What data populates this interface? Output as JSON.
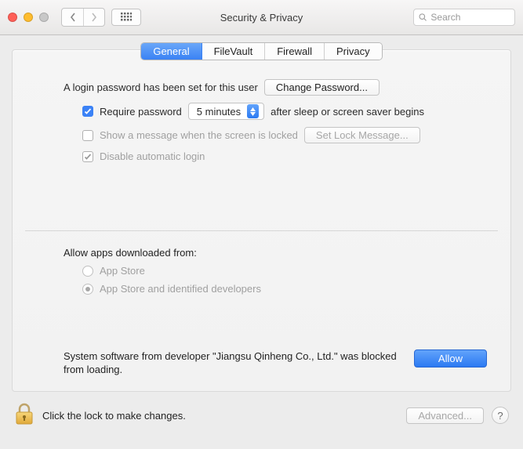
{
  "titlebar": {
    "title": "Security & Privacy",
    "search_placeholder": "Search"
  },
  "tabs": {
    "general": "General",
    "filevault": "FileVault",
    "firewall": "Firewall",
    "privacy": "Privacy"
  },
  "login": {
    "password_set": "A login password has been set for this user",
    "change_password": "Change Password...",
    "require_password": "Require password",
    "delay_value": "5 minutes",
    "after_sleep": "after sleep or screen saver begins",
    "show_message": "Show a message when the screen is locked",
    "set_lock_message": "Set Lock Message...",
    "disable_auto_login": "Disable automatic login"
  },
  "downloads": {
    "heading": "Allow apps downloaded from:",
    "app_store": "App Store",
    "identified": "App Store and identified developers"
  },
  "blocked": {
    "text": "System software from developer \"Jiangsu Qinheng Co., Ltd.\" was blocked from loading.",
    "allow": "Allow"
  },
  "footer": {
    "lock_text": "Click the lock to make changes.",
    "advanced": "Advanced...",
    "help": "?"
  }
}
